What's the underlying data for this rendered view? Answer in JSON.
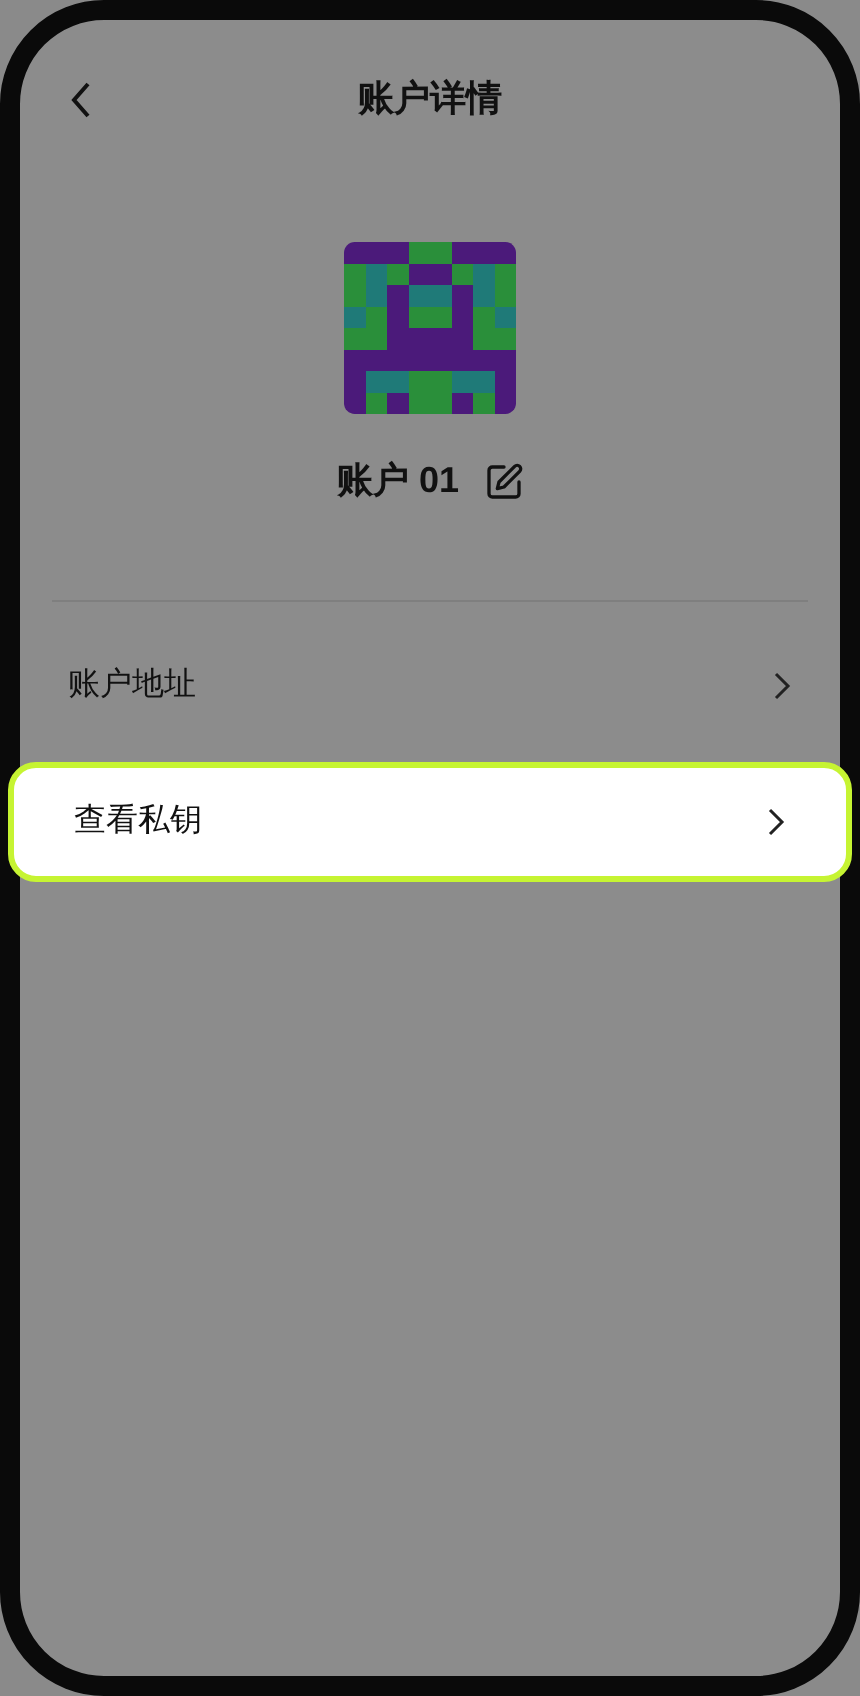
{
  "header": {
    "title": "账户详情"
  },
  "account": {
    "name": "账户 01"
  },
  "menu": [
    {
      "label": "账户地址",
      "selected": false
    },
    {
      "label": "查看私钥",
      "selected": true
    }
  ]
}
